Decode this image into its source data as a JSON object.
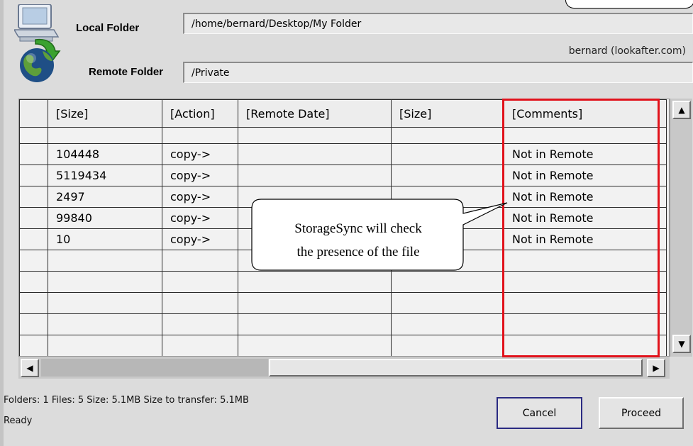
{
  "header": {
    "local_label": "Local Folder",
    "local_path": "/home/bernard/Desktop/My Folder",
    "remote_label": "Remote Folder",
    "remote_path": "/Private",
    "account": "bernard (lookafter.com)"
  },
  "table": {
    "columns": [
      "",
      "[Size]",
      "[Action]",
      "[Remote Date]",
      "[Size]",
      "[Comments]"
    ],
    "rows": [
      [
        "",
        "",
        "",
        "",
        "",
        ""
      ],
      [
        "",
        "104448",
        "copy->",
        "",
        "",
        "Not in Remote"
      ],
      [
        "",
        "5119434",
        "copy->",
        "",
        "",
        "Not in Remote"
      ],
      [
        "",
        "2497",
        "copy->",
        "",
        "",
        "Not in Remote"
      ],
      [
        "",
        "99840",
        "copy->",
        "",
        "",
        "Not in Remote"
      ],
      [
        "",
        "10",
        "copy->",
        "",
        "",
        "Not in Remote"
      ],
      [
        "",
        "",
        "",
        "",
        "",
        ""
      ],
      [
        "",
        "",
        "",
        "",
        "",
        ""
      ],
      [
        "",
        "",
        "",
        "",
        "",
        ""
      ],
      [
        "",
        "",
        "",
        "",
        "",
        ""
      ],
      [
        "",
        "",
        "",
        "",
        "",
        ""
      ]
    ]
  },
  "callout": {
    "line1": "StorageSync will check",
    "line2": "the presence of the file"
  },
  "status": {
    "summary": "Folders: 1  Files: 5  Size: 5.1MB  Size to transfer: 5.1MB",
    "state": "Ready"
  },
  "buttons": {
    "cancel": "Cancel",
    "proceed": "Proceed"
  },
  "icons": {
    "computer": "computer-icon",
    "sync_arrow": "green-arrow-icon",
    "globe": "globe-icon",
    "scroll_up": "arrow-up-icon",
    "scroll_down": "arrow-down-icon",
    "scroll_left": "arrow-left-icon",
    "scroll_right": "arrow-right-icon"
  },
  "colors": {
    "highlight": "#e1121b",
    "button_focus": "#2a2a82",
    "sync_arrow": "#3aa22f"
  }
}
